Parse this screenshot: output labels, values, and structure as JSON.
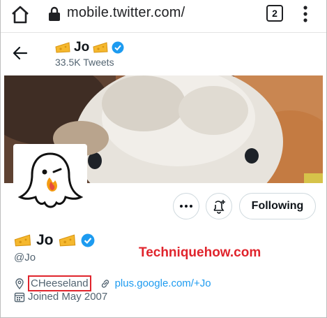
{
  "browser": {
    "url": "mobile.twitter.com/",
    "tab_count": "2"
  },
  "header": {
    "name": "Jo",
    "tweet_count": "33.5K Tweets"
  },
  "profile": {
    "name": "Jo",
    "handle": "@Jo",
    "location": "CHeeseland",
    "website": "plus.google.com/+Jo",
    "joined": "Joined May 2007"
  },
  "actions": {
    "follow_label": "Following"
  },
  "watermark": "Techniquehow.com",
  "colors": {
    "accent": "#1d9bf0",
    "highlight": "#e0242c",
    "secondary_text": "#536471"
  },
  "icons": [
    "home-icon",
    "lock-icon",
    "kebab-icon",
    "back-icon",
    "cheese-icon",
    "verified-icon",
    "more-icon",
    "bell-plus-icon",
    "location-icon",
    "link-icon",
    "calendar-icon"
  ]
}
